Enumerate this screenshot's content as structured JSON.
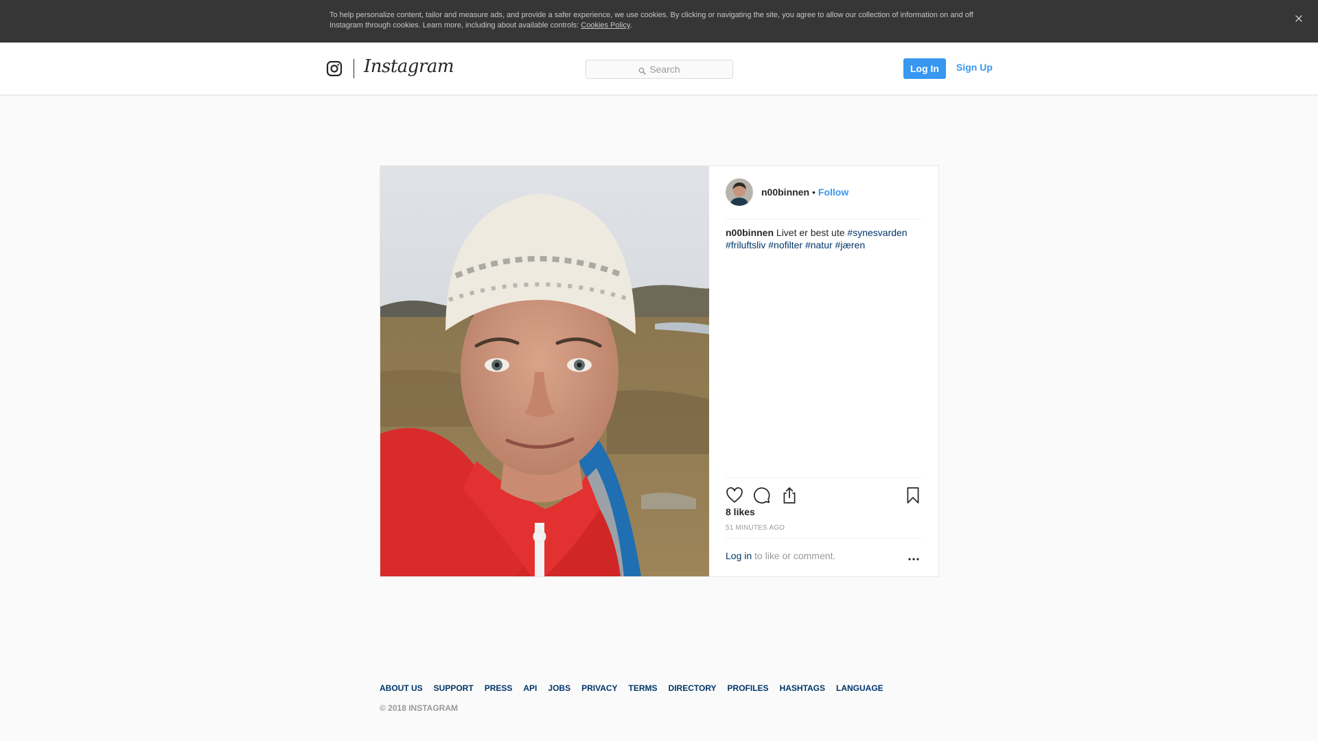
{
  "cookie_banner": {
    "text": "To help personalize content, tailor and measure ads, and provide a safer experience, we use cookies. By clicking or navigating the site, you agree to allow our collection of information on and off Instagram through cookies. Learn more, including about available controls: ",
    "link_label": "Cookies Policy",
    "trailing": ".",
    "close_icon": "close-icon"
  },
  "header": {
    "logo_icon": "instagram-glyph-icon",
    "wordmark": "Instagram",
    "search": {
      "placeholder": "Search",
      "icon": "search-icon"
    },
    "login_label": "Log In",
    "signup_label": "Sign Up"
  },
  "post": {
    "photo_description_icon": "post-photo",
    "author": "n00binnen",
    "separator": "•",
    "follow_label": "Follow",
    "caption": {
      "user": "n00binnen",
      "text": "Livet er best ute ",
      "emoji": "",
      "hashtags": [
        "#synesvarden",
        "#friluftsliv",
        "#nofilter",
        "#natur",
        "#jæren"
      ]
    },
    "actions": [
      "heart-icon",
      "comment-icon",
      "share-icon",
      "bookmark-icon"
    ],
    "likes": "8 likes",
    "time_ago": "51 MINUTES AGO",
    "login_prompt": {
      "link": "Log in",
      "rest": " to like or comment."
    },
    "more_icon": "more-options-icon"
  },
  "footer": {
    "links": [
      "ABOUT US",
      "SUPPORT",
      "PRESS",
      "API",
      "JOBS",
      "PRIVACY",
      "TERMS",
      "DIRECTORY",
      "PROFILES",
      "HASHTAGS",
      "LANGUAGE"
    ],
    "copyright": "© 2018 INSTAGRAM"
  },
  "colors": {
    "accent": "#3897f0",
    "link_dark": "#003569",
    "banner_bg": "#363636"
  }
}
